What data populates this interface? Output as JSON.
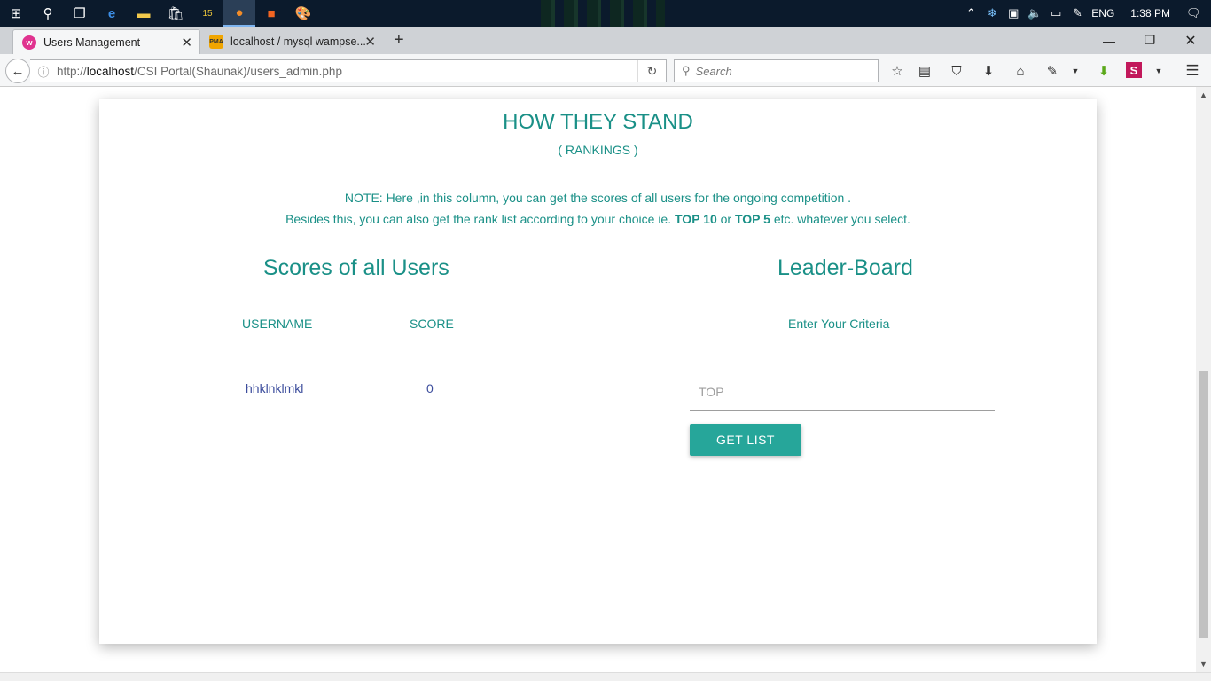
{
  "taskbar": {
    "clock": "1:38 PM",
    "language": "ENG",
    "apps": [
      "start",
      "search",
      "task-view",
      "edge",
      "file-explorer",
      "store",
      "app15",
      "firefox",
      "sublime",
      "paint"
    ]
  },
  "browser": {
    "tabs": [
      {
        "title": "Users Management",
        "active": true
      },
      {
        "title": "localhost / mysql wampse...",
        "active": false
      }
    ],
    "url_prefix": "http://",
    "url_host": "localhost",
    "url_path": "/CSI Portal(Shaunak)/users_admin.php",
    "search_placeholder": "Search"
  },
  "page": {
    "title": "HOW THEY STAND",
    "subtitle": "( RANKINGS )",
    "note_line1": "NOTE: Here ,in this column, you can get the scores of all users for the ongoing competition .",
    "note_line2_a": "Besides this, you can also get the rank list according to your choice ie. ",
    "note_top10": "TOP 10",
    "note_or": " or ",
    "note_top5": "TOP 5",
    "note_line2_b": " etc. whatever you select.",
    "scores_title": "Scores of all Users",
    "col_username": "USERNAME",
    "col_score": "SCORE",
    "rows": [
      {
        "username": "hhklnklmkl",
        "score": "0"
      }
    ],
    "leader_title": "Leader-Board",
    "criteria_label": "Enter Your Criteria",
    "top_placeholder": "TOP",
    "get_list_label": "GET LIST"
  },
  "colors": {
    "accent": "#1a9087",
    "button": "#26a69a",
    "row_text": "#3b4c9c"
  }
}
